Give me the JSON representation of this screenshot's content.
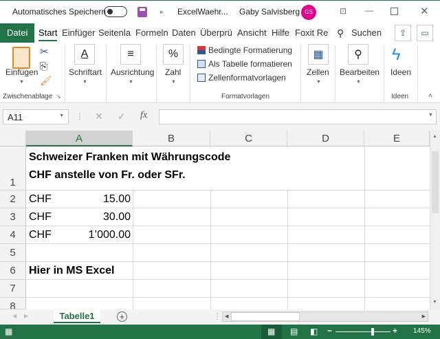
{
  "titlebar": {
    "autosave_label": "Automatisches Speichern",
    "filename": "ExcelWaehr...",
    "user": "Gaby Salvisberg",
    "initials": "GS",
    "more": "»"
  },
  "tabs": [
    "Datei",
    "Start",
    "Einfüger",
    "Seitenla",
    "Formeln",
    "Daten",
    "Überprü",
    "Ansicht",
    "Hilfe",
    "Foxit Re"
  ],
  "search_label": "Suchen",
  "ribbon": {
    "einfuegen": "Einfügen",
    "schriftart": "Schriftart",
    "ausrichtung": "Ausrichtung",
    "zahl": "Zahl",
    "bedingte": "Bedingte Formatierung",
    "als_tabelle": "Als Tabelle formatieren",
    "zellformat": "Zellenformatvorlagen",
    "zellen": "Zellen",
    "bearbeiten": "Bearbeiten",
    "ideen": "Ideen",
    "group_clipboard": "Zwischenablage",
    "group_styles": "Formatvorlagen",
    "group_ideas": "Ideen"
  },
  "formula_bar": {
    "name_box": "A11",
    "fx": "fx",
    "cancel": "✕",
    "enter": "✓",
    "content": ""
  },
  "columns": [
    "A",
    "B",
    "C",
    "D",
    "E"
  ],
  "rows": [
    "1",
    "2",
    "3",
    "4",
    "5",
    "6",
    "7",
    "8"
  ],
  "cells": {
    "A1_line1": "Schweizer Franken mit Währungscode",
    "A1_line2": "CHF anstelle von Fr. oder SFr.",
    "A2_cur": "CHF",
    "A2_val": "15.00",
    "A3_cur": "CHF",
    "A3_val": "30.00",
    "A4_cur": "CHF",
    "A4_val": "1’000.00",
    "A6": "Hier in MS Excel"
  },
  "sheet_tabs": [
    "Tabelle1"
  ],
  "status": {
    "zoom": "145%"
  },
  "colors": {
    "accent": "#217346",
    "avatar": "#e3008c"
  }
}
